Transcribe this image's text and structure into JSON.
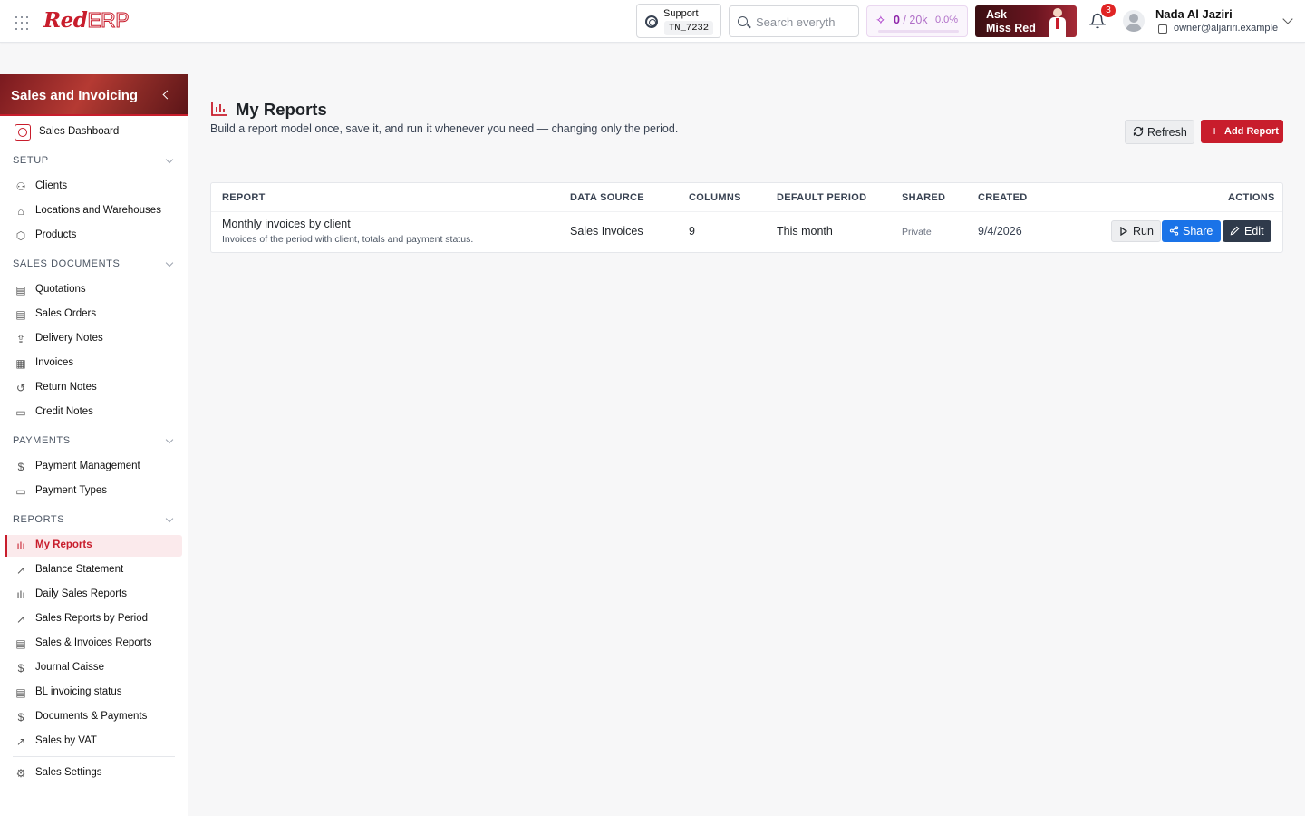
{
  "app": {
    "logo_red": "Red",
    "logo_erp": "ERP"
  },
  "topbar": {
    "support_label": "Support",
    "support_code": "TN_7232",
    "search_placeholder": "Search everyth",
    "quota_used": "0",
    "quota_limit": "20k",
    "quota_percent": "0.0%",
    "quota_fraction": 0,
    "ask_line1": "Ask",
    "ask_line2": "Miss Red",
    "notifications_count": "3",
    "user_name": "Nada Al Jaziri",
    "user_email": "owner@aljariri.example"
  },
  "sidebar": {
    "title": "Sales and Invoicing",
    "dashboard": "Sales Dashboard",
    "sections": {
      "setup": "SETUP",
      "sales_documents": "SALES DOCUMENTS",
      "payments": "PAYMENTS",
      "reports": "REPORTS"
    },
    "setup_items": [
      "Clients",
      "Locations and Warehouses",
      "Products"
    ],
    "sales_documents_items": [
      "Quotations",
      "Sales Orders",
      "Delivery Notes",
      "Invoices",
      "Return Notes",
      "Credit Notes"
    ],
    "payments_items": [
      "Payment Management",
      "Payment Types"
    ],
    "reports_items": [
      "My Reports",
      "Balance Statement",
      "Daily Sales Reports",
      "Sales Reports by Period",
      "Sales & Invoices Reports",
      "Journal Caisse",
      "BL invoicing status",
      "Documents & Payments",
      "Sales by VAT"
    ],
    "settings": "Sales Settings"
  },
  "main": {
    "title": "My Reports",
    "subtitle": "Build a report model once, save it, and run it whenever you need — changing only the period.",
    "refresh_label": "Refresh",
    "add_label": "Add Report",
    "columns": {
      "report": "REPORT",
      "data_source": "DATA SOURCE",
      "columns": "COLUMNS",
      "default_period": "DEFAULT PERIOD",
      "shared": "SHARED",
      "created": "CREATED",
      "actions": "ACTIONS"
    },
    "rows": [
      {
        "title": "Monthly invoices by client",
        "description": "Invoices of the period with client, totals and payment status.",
        "data_source": "Sales Invoices",
        "columns": "9",
        "default_period": "This month",
        "shared": "Private",
        "created": "9/4/2026",
        "run_label": "Run",
        "share_label": "Share",
        "edit_label": "Edit"
      }
    ]
  },
  "colors": {
    "brand": "#c81d2c",
    "share": "#1a73e8",
    "edit": "#2f3a4b",
    "quota": "#a021c4"
  }
}
